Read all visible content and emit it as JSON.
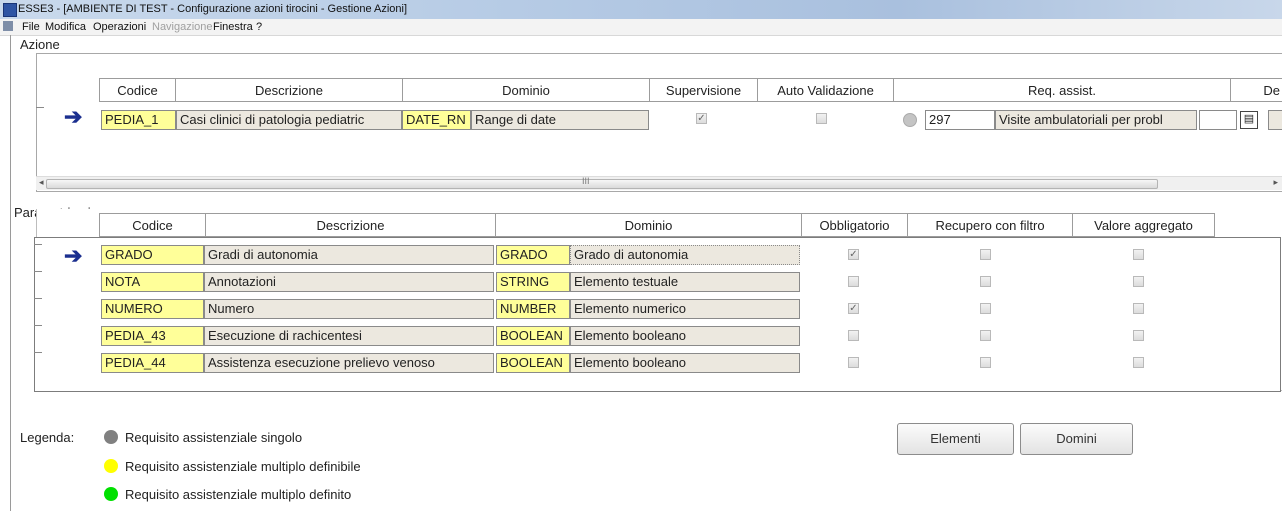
{
  "window": {
    "title": "ESSE3 - [AMBIENTE DI TEST - Configurazione azioni tirocini - Gestione Azioni]"
  },
  "menu": {
    "file": "File",
    "modifica": "Modifica",
    "operazioni": "Operazioni",
    "navigazione": "Navigazione",
    "finestra": "Finestra",
    "help": "?"
  },
  "azione": {
    "section_label": "Azione",
    "headers": {
      "codice": "Codice",
      "descrizione": "Descrizione",
      "dominio": "Dominio",
      "supervisione": "Supervisione",
      "auto_validazione": "Auto Validazione",
      "req_assist": "Req. assist.",
      "de": "De"
    },
    "row": {
      "codice": "PEDIA_1",
      "descrizione": "Casi clinici di patologia pediatric",
      "dominio_code": "DATE_RN",
      "dominio_desc": "Range di date",
      "supervisione": true,
      "auto_validazione": false,
      "req_code": "297",
      "req_desc": "Visite ambulatoriali per probl"
    },
    "scroll_center_mark": "III"
  },
  "parametri": {
    "section_label": "Parametri azione",
    "headers": {
      "codice": "Codice",
      "descrizione": "Descrizione",
      "dominio": "Dominio",
      "obbligatorio": "Obbligatorio",
      "recupero": "Recupero con filtro",
      "valore": "Valore aggregato"
    },
    "rows": [
      {
        "codice": "GRADO",
        "descrizione": "Gradi di autonomia",
        "dom_code": "GRADO",
        "dom_desc": "Grado di autonomia",
        "obbligatorio": true,
        "recupero": false,
        "valore": false
      },
      {
        "codice": "NOTA",
        "descrizione": "Annotazioni",
        "dom_code": "STRING",
        "dom_desc": "Elemento testuale",
        "obbligatorio": false,
        "recupero": false,
        "valore": false
      },
      {
        "codice": "NUMERO",
        "descrizione": "Numero",
        "dom_code": "NUMBER",
        "dom_desc": "Elemento numerico",
        "obbligatorio": true,
        "recupero": false,
        "valore": false
      },
      {
        "codice": "PEDIA_43",
        "descrizione": "Esecuzione di rachicentesi",
        "dom_code": "BOOLEAN",
        "dom_desc": "Elemento booleano",
        "obbligatorio": false,
        "recupero": false,
        "valore": false
      },
      {
        "codice": "PEDIA_44",
        "descrizione": "Assistenza esecuzione prelievo venoso",
        "dom_code": "BOOLEAN",
        "dom_desc": "Elemento booleano",
        "obbligatorio": false,
        "recupero": false,
        "valore": false
      }
    ]
  },
  "legenda": {
    "label": "Legenda:",
    "items": [
      {
        "text": "Requisito assistenziale singolo",
        "color": "#808080"
      },
      {
        "text": "Requisito assistenziale multiplo definibile",
        "color": "#ffff00"
      },
      {
        "text": "Requisito assistenziale multiplo definito",
        "color": "#00e000"
      }
    ]
  },
  "buttons": {
    "elementi": "Elementi",
    "domini": "Domini"
  },
  "colors": {
    "codice_bg": "#ffff99",
    "desc_bg": "#ece8df",
    "arrow": "#1b2f8f"
  }
}
